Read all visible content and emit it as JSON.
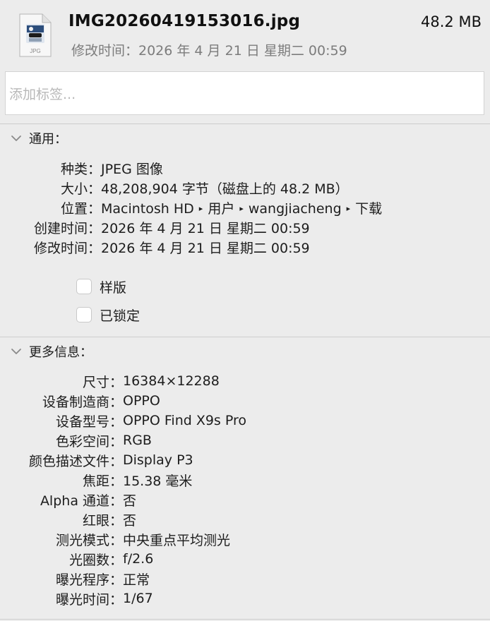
{
  "header": {
    "file_name": "IMG20260419153016.jpg",
    "file_size": "48.2 MB",
    "modified_line": "修改时间：2026 年 4 月 21 日 星期二 00:59",
    "icon": "jpg-file-icon",
    "icon_caption": "JPG"
  },
  "tags": {
    "placeholder": "添加标签...",
    "value": ""
  },
  "general": {
    "title": "通用：",
    "chevron": "chevron-down-icon",
    "kind": {
      "label": "种类：",
      "value": "JPEG 图像"
    },
    "size": {
      "label": "大小：",
      "value": "48,208,904 字节（磁盘上的 48.2 MB）"
    },
    "where": {
      "label": "位置：",
      "segments": [
        "Macintosh HD",
        "用户",
        "wangjiacheng",
        "下载"
      ],
      "separator_icon": "path-arrow-icon"
    },
    "created": {
      "label": "创建时间：",
      "value": "2026 年 4 月 21 日 星期二 00:59"
    },
    "modified": {
      "label": "修改时间：",
      "value": "2026 年 4 月 21 日 星期二 00:59"
    },
    "stationery": {
      "label": "样版",
      "checked": false
    },
    "locked": {
      "label": "已锁定",
      "checked": false
    }
  },
  "more_info": {
    "title": "更多信息：",
    "chevron": "chevron-down-icon",
    "rows": [
      {
        "label": "尺寸：",
        "value": "16384×12288"
      },
      {
        "label": "设备制造商：",
        "value": "OPPO"
      },
      {
        "label": "设备型号：",
        "value": "OPPO Find X9s Pro"
      },
      {
        "label": "色彩空间：",
        "value": "RGB"
      },
      {
        "label": "颜色描述文件：",
        "value": "Display P3"
      },
      {
        "label": "焦距：",
        "value": "15.38 毫米"
      },
      {
        "label": "Alpha 通道：",
        "value": "否"
      },
      {
        "label": "红眼：",
        "value": "否"
      },
      {
        "label": "测光模式：",
        "value": "中央重点平均测光"
      },
      {
        "label": "光圈数：",
        "value": "f/2.6"
      },
      {
        "label": "曝光程序：",
        "value": "正常"
      },
      {
        "label": "曝光时间：",
        "value": "1/67"
      }
    ]
  }
}
